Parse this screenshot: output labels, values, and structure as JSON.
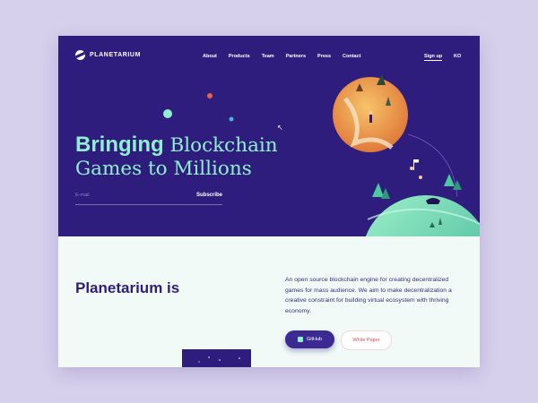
{
  "brand": {
    "logo_text": "PLANETARIUM"
  },
  "nav": {
    "items": [
      "About",
      "Products",
      "Team",
      "Partners",
      "Press",
      "Contact"
    ],
    "signup_label": "Sign up",
    "language_label": "KO"
  },
  "hero": {
    "headline_bold": "Bringing",
    "headline_rest_line1": " Blockchain",
    "headline_line2": "Games to Millions",
    "email_placeholder": "E-mail",
    "subscribe_label": "Subscribe"
  },
  "about": {
    "title": "Planetarium is",
    "description": "An open source blockchain engine for creating decentralized games for mass audience. We aim to make decentralization a creative constraint for building virtual ecosystem with thriving economy.",
    "github_label": "GitHub",
    "whitepaper_label": "White Paper"
  },
  "colors": {
    "page_background": "#d6d0ec",
    "hero_background": "#2f1d7e",
    "headline": "#8ff0cf",
    "body_background": "#f1faf7",
    "accent_red": "#e04e4e"
  },
  "icons": [
    "planet-logo-icon",
    "github-icon",
    "cursor-icon"
  ]
}
